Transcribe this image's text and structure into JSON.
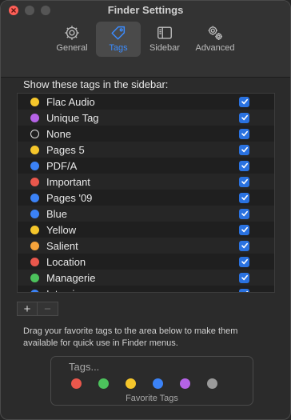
{
  "window": {
    "title": "Finder Settings"
  },
  "toolbar": {
    "tabs": [
      {
        "label": "General",
        "icon": "gear-icon",
        "active": false
      },
      {
        "label": "Tags",
        "icon": "tag-icon",
        "active": true
      },
      {
        "label": "Sidebar",
        "icon": "sidebar-icon",
        "active": false
      },
      {
        "label": "Advanced",
        "icon": "gears-icon",
        "active": false
      }
    ]
  },
  "tags_section": {
    "label": "Show these tags in the sidebar:",
    "items": [
      {
        "name": "Flac Audio",
        "color": "#f5c62b",
        "checked": true
      },
      {
        "name": "Unique Tag",
        "color": "#b563e6",
        "checked": true
      },
      {
        "name": "None",
        "color": "none",
        "checked": true
      },
      {
        "name": "Pages 5",
        "color": "#f5c62b",
        "checked": true
      },
      {
        "name": "PDF/A",
        "color": "#3b82f6",
        "checked": true
      },
      {
        "name": "Important",
        "color": "#e9574c",
        "checked": true
      },
      {
        "name": "Pages '09",
        "color": "#3b82f6",
        "checked": true
      },
      {
        "name": "Blue",
        "color": "#3b82f6",
        "checked": true
      },
      {
        "name": "Yellow",
        "color": "#f5c62b",
        "checked": true
      },
      {
        "name": "Salient",
        "color": "#f5a33b",
        "checked": true
      },
      {
        "name": "Location",
        "color": "#e9574c",
        "checked": true
      },
      {
        "name": "Managerie",
        "color": "#4cc25c",
        "checked": true
      },
      {
        "name": "Interview",
        "color": "#3b82f6",
        "checked": true
      }
    ]
  },
  "buttons": {
    "add_label": "+",
    "remove_label": "−"
  },
  "hint": "Drag your favorite tags to the area below to make them available for quick use in Finder menus.",
  "favorites": {
    "placeholder": "Tags...",
    "caption": "Favorite Tags",
    "colors": [
      "#e9574c",
      "#4cc25c",
      "#f5c62b",
      "#3b82f6",
      "#b563e6",
      "#9a9a9a"
    ]
  },
  "colors": {
    "accent": "#3b8cff",
    "checkbox": "#2a72e0"
  }
}
